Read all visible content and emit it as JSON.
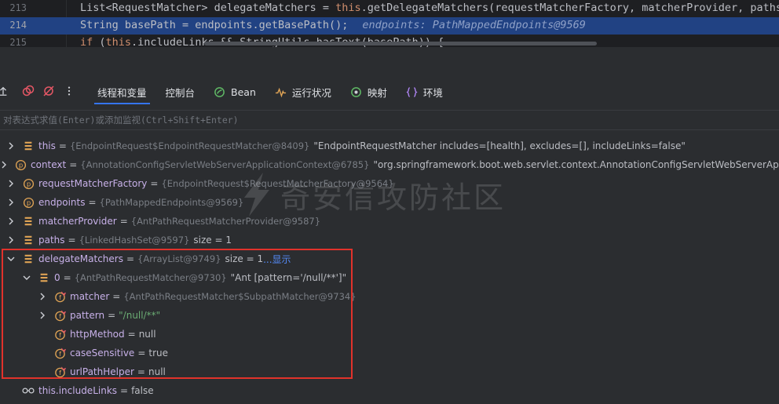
{
  "editor": {
    "lines": [
      {
        "num": "213",
        "tokens": [
          {
            "t": "List<RequestMatcher> delegateMatchers = ",
            "k": ""
          },
          {
            "t": "this",
            "k": "kw"
          },
          {
            "t": ".getDelegateMatchers(requestMatcherFactory, matcherProvider, paths);",
            "k": ""
          }
        ]
      },
      {
        "num": "214",
        "tokens": [
          {
            "t": "String basePath = endpoints.getBasePath();",
            "k": ""
          }
        ],
        "hint": "endpoints: PathMappedEndpoints@9569"
      },
      {
        "num": "215",
        "tokens": [
          {
            "t": "if",
            "k": "kw"
          },
          {
            "t": " (",
            "k": ""
          },
          {
            "t": "this",
            "k": "kw"
          },
          {
            "t": ".includeLinks && StringUtils.hasText(basePath)) {",
            "k": ""
          }
        ]
      }
    ]
  },
  "toolbar": {
    "tabs": [
      {
        "label": "线程和变量",
        "icon": "",
        "active": true
      },
      {
        "label": "控制台",
        "icon": "",
        "active": false
      },
      {
        "label": "Bean",
        "icon": "bean-icon",
        "active": false
      },
      {
        "label": "运行状况",
        "icon": "health-icon",
        "active": false
      },
      {
        "label": "映射",
        "icon": "mapping-icon",
        "active": false
      },
      {
        "label": "环境",
        "icon": "environment-icon",
        "active": false
      }
    ]
  },
  "evaluate": {
    "placeholder": "对表达式求值(Enter)或添加监视(Ctrl+Shift+Enter)"
  },
  "watermark": {
    "text": "奇安信攻防社区"
  },
  "variables": [
    {
      "indent": 0,
      "expand": "collapsed",
      "icon": "field-icon",
      "name": "this",
      "ref": "{EndpointRequest$EndpointRequestMatcher@8409}",
      "value": "\"EndpointRequestMatcher includes=[health], excludes=[], includeLinks=false\"",
      "valueKind": "plain"
    },
    {
      "indent": 0,
      "expand": "collapsed",
      "icon": "parameter-icon",
      "name": "context",
      "ref": "{AnnotationConfigServletWebServerApplicationContext@6785}",
      "value": "\"org.springframework.boot.web.servlet.context.AnnotationConfigServletWebServerApplica",
      "valueKind": "plain"
    },
    {
      "indent": 0,
      "expand": "collapsed",
      "icon": "parameter-icon",
      "name": "requestMatcherFactory",
      "ref": "{EndpointRequest$RequestMatcherFactory@9564}",
      "value": "",
      "valueKind": "plain"
    },
    {
      "indent": 0,
      "expand": "collapsed",
      "icon": "parameter-icon",
      "name": "endpoints",
      "ref": "{PathMappedEndpoints@9569}",
      "value": "",
      "valueKind": "plain"
    },
    {
      "indent": 0,
      "expand": "collapsed",
      "icon": "field-icon",
      "name": "matcherProvider",
      "ref": "{AntPathRequestMatcherProvider@9587}",
      "value": "",
      "valueKind": "plain"
    },
    {
      "indent": 0,
      "expand": "collapsed",
      "icon": "field-icon",
      "name": "paths",
      "ref": "{LinkedHashSet@9597}",
      "value": "size = 1",
      "valueKind": "plain"
    },
    {
      "indent": 0,
      "expand": "expanded",
      "icon": "field-icon",
      "name": "delegateMatchers",
      "ref": "{ArrayList@9749}",
      "value": "size = 1",
      "valueKind": "plain",
      "link": "...显示"
    },
    {
      "indent": 1,
      "expand": "expanded",
      "icon": "field-icon",
      "name": "0",
      "ref": "{AntPathRequestMatcher@9730}",
      "value": "\"Ant [pattern='/null/**']\"",
      "valueKind": "plain"
    },
    {
      "indent": 2,
      "expand": "collapsed",
      "icon": "object-field-icon",
      "name": "matcher",
      "ref": "{AntPathRequestMatcher$SubpathMatcher@9734}",
      "value": "",
      "valueKind": "plain"
    },
    {
      "indent": 2,
      "expand": "collapsed",
      "icon": "object-field-icon",
      "name": "pattern",
      "ref": "",
      "value": "\"/null/**\"",
      "valueKind": "string"
    },
    {
      "indent": 2,
      "expand": "none",
      "icon": "object-field-icon",
      "name": "httpMethod",
      "ref": "",
      "value": "null",
      "valueKind": "plain"
    },
    {
      "indent": 2,
      "expand": "none",
      "icon": "object-field-icon",
      "name": "caseSensitive",
      "ref": "",
      "value": "true",
      "valueKind": "plain"
    },
    {
      "indent": 2,
      "expand": "none",
      "icon": "object-field-icon",
      "name": "urlPathHelper",
      "ref": "",
      "value": "null",
      "valueKind": "plain"
    },
    {
      "indent": 0,
      "expand": "none",
      "icon": "watch-glasses-icon",
      "name": "this.includeLinks",
      "ref": "",
      "value": "false",
      "valueKind": "plain"
    }
  ],
  "colors": {
    "editor_bg": "#1e1f22",
    "panel_bg": "#2b2d30",
    "highlight_line": "#214283",
    "keyword": "#cf8e6d",
    "string": "#6aab73",
    "link": "#548af7",
    "red_box": "#e1322b",
    "accent": "#3574f0"
  }
}
